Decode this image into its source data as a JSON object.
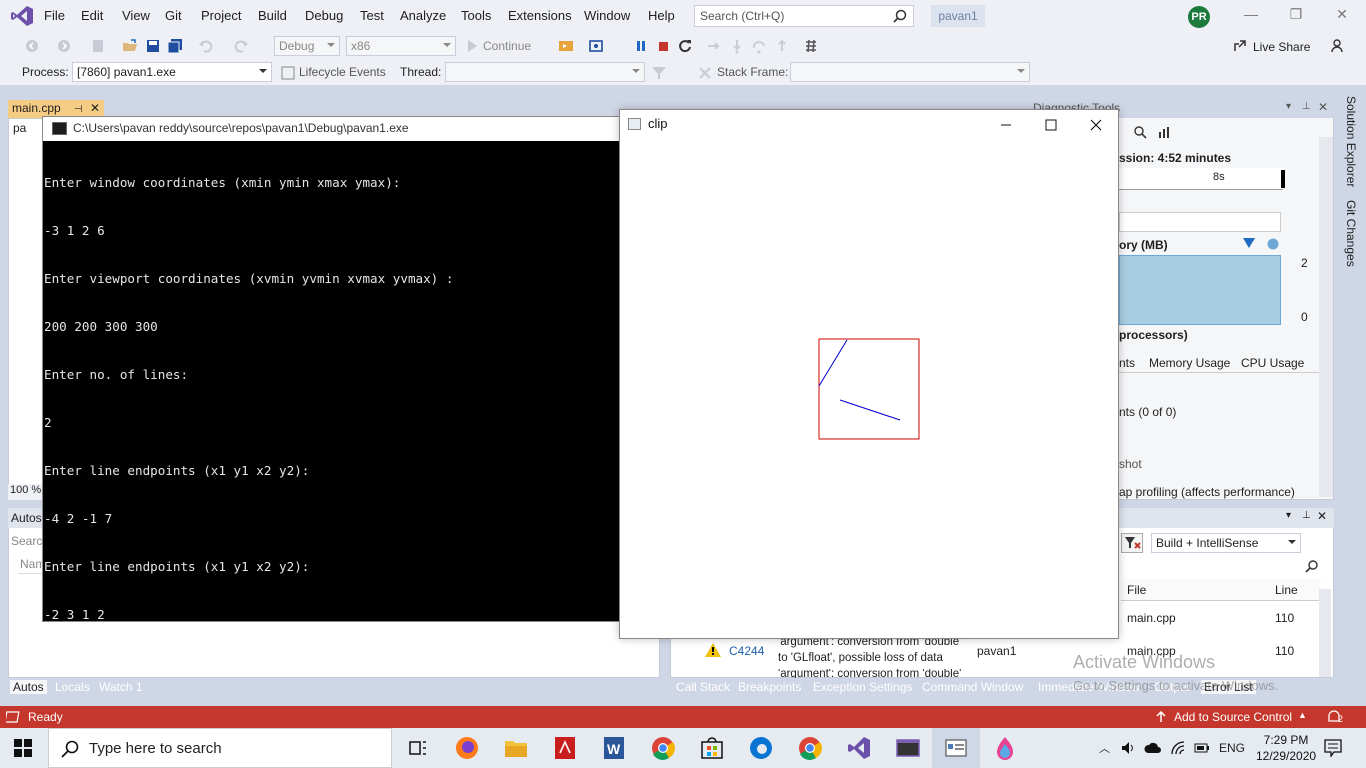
{
  "vs": {
    "menu": [
      "File",
      "Edit",
      "View",
      "Git",
      "Project",
      "Build",
      "Debug",
      "Test",
      "Analyze",
      "Tools",
      "Extensions",
      "Window",
      "Help"
    ],
    "search_placeholder": "Search (Ctrl+Q)",
    "solution": "pavan1",
    "user_initials": "PR",
    "toolbar": {
      "config": "Debug",
      "platform": "x86",
      "continue_label": "Continue",
      "live_share": "Live Share",
      "process_label": "Process:",
      "process_value": "[7860] pavan1.exe",
      "lifecycle_label": "Lifecycle Events",
      "thread_label": "Thread:",
      "stackframe_label": "Stack Frame:"
    },
    "doc_tab": "main.cpp",
    "doc_tab_2": "pa",
    "zoom": "100 %",
    "autos": {
      "title": "Autos",
      "search": "Search",
      "col_name": "Nam"
    },
    "bottom_left_tabs": [
      "Autos",
      "Locals",
      "Watch 1"
    ],
    "diagnostics": {
      "title": "Diagnostic Tools",
      "session": "ssion: 4:52 minutes",
      "timeline_label": "8s",
      "memory_label": "ory (MB)",
      "mem_max": "2",
      "mem_min": "0",
      "cpu_label": "processors)",
      "tabs": [
        "nts",
        "Memory Usage",
        "CPU Usage"
      ],
      "events_count": "nts (0 of 0)",
      "snapshot": "shot",
      "heap_profiling": "ap profiling (affects performance)"
    },
    "error_list": {
      "filter": "Build + IntelliSense",
      "col_file": "File",
      "col_line": "Line",
      "rows": [
        {
          "file": "main.cpp",
          "line": "110"
        },
        {
          "code": "C4244",
          "desc1": "'argument': conversion from 'double'",
          "desc2": "to 'GLfloat', possible loss of data",
          "project": "pavan1",
          "file": "main.cpp",
          "line": "110"
        }
      ],
      "row3_partial": "'argument': conversion from 'double'"
    },
    "bottom_right_tabs": [
      "Call Stack",
      "Breakpoints",
      "Exception Settings",
      "Command Window",
      "Immediate Window",
      "Output",
      "Error List"
    ],
    "side_tabs": [
      "Solution Explorer",
      "Git Changes"
    ],
    "status": {
      "ready": "Ready",
      "source_control": "Add to Source Control",
      "notifications": "2"
    },
    "watermark_title": "Activate Windows",
    "watermark_sub": "Go to Settings to activate Windows."
  },
  "console": {
    "title": "C:\\Users\\pavan reddy\\source\\repos\\pavan1\\Debug\\pavan1.exe",
    "lines": [
      "Enter window coordinates (xmin ymin xmax ymax):",
      "-3 1 2 6",
      "Enter viewport coordinates (xvmin yvmin xvmax yvmax) :",
      "200 200 300 300",
      "Enter no. of lines:",
      "2",
      "Enter line endpoints (x1 y1 x2 y2):",
      "-4 2 -1 7",
      "Enter line endpoints (x1 y1 x2 y2):",
      "-2 3 1 2"
    ]
  },
  "clip_window": {
    "title": "clip",
    "viewport_color": "#d00000",
    "line_color": "#0000cc"
  },
  "taskbar": {
    "search_placeholder": "Type here to search",
    "language": "ENG",
    "time": "7:29 PM",
    "date": "12/29/2020"
  }
}
